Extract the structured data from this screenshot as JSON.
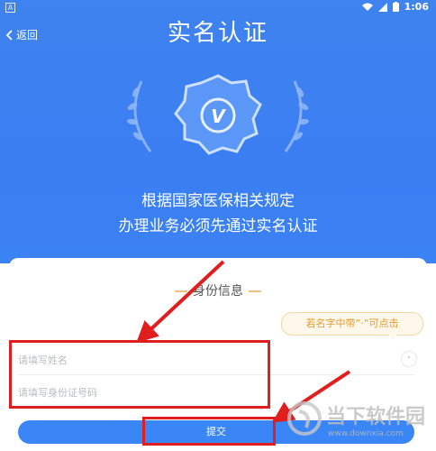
{
  "status_bar": {
    "app_badge": "A",
    "time": "1:06"
  },
  "header": {
    "back_label": "返回",
    "title": "实名认证"
  },
  "badge": {
    "letter": "V"
  },
  "description": {
    "line1": "根据国家医保相关规定",
    "line2": "办理业务必须先通过实名认证"
  },
  "form": {
    "section_title": "身份信息",
    "tooltip": "若名字中带“·”可点击",
    "dot_button": "·",
    "name_placeholder": "请填写姓名",
    "id_placeholder": "请填写身份证号码",
    "submit_label": "提交"
  },
  "watermark": {
    "text": "当下软件园",
    "url": "www.downxia.com"
  },
  "colors": {
    "primary": "#3b82f4",
    "annotation": "#e01e1e",
    "tooltip": "#e49a2c"
  }
}
